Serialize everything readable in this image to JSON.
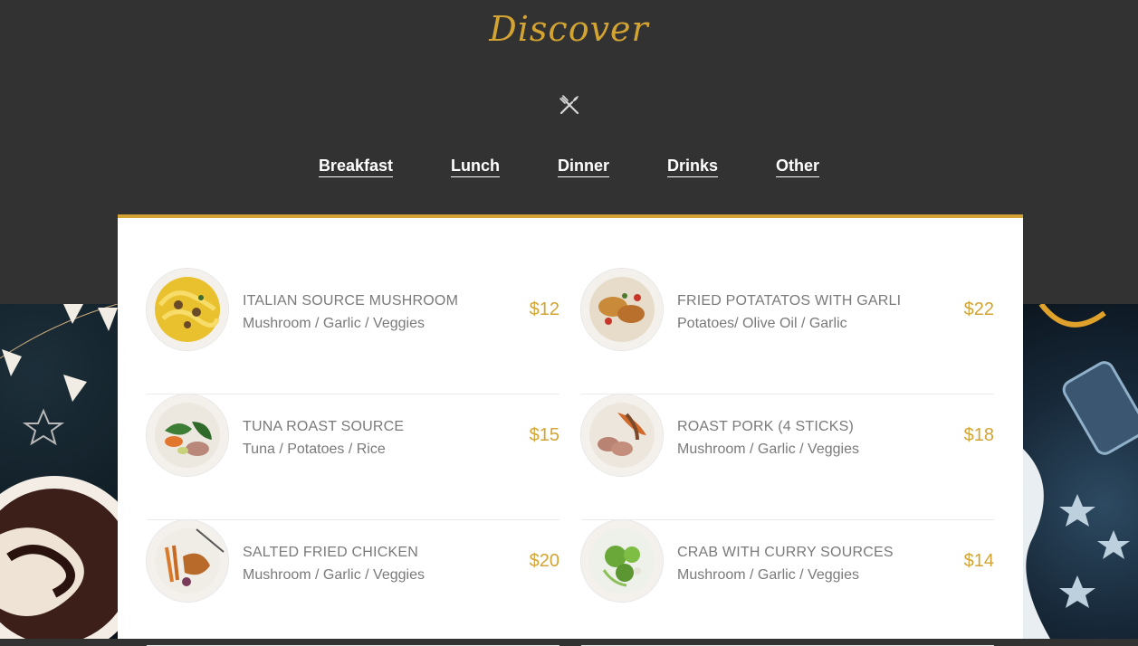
{
  "header": {
    "title": "Discover",
    "icon": "utensils-icon"
  },
  "tabs": [
    {
      "label": "Breakfast"
    },
    {
      "label": "Lunch"
    },
    {
      "label": "Dinner"
    },
    {
      "label": "Drinks"
    },
    {
      "label": "Other"
    }
  ],
  "colors": {
    "accent": "#d4a432",
    "background": "#323232",
    "text": "#7a7a7a"
  },
  "menu": {
    "items": [
      {
        "name": "ITALIAN SOURCE MUSHROOM",
        "desc": "Mushroom / Garlic / Veggies",
        "price": "$12"
      },
      {
        "name": "FRIED POTATATOS WITH GARLI",
        "desc": "Potatoes/ Olive Oil / Garlic",
        "price": "$22"
      },
      {
        "name": "TUNA ROAST SOURCE",
        "desc": "Tuna / Potatoes / Rice",
        "price": "$15"
      },
      {
        "name": "ROAST PORK (4 STICKS)",
        "desc": "Mushroom / Garlic / Veggies",
        "price": "$18"
      },
      {
        "name": "SALTED FRIED CHICKEN",
        "desc": "Mushroom / Garlic / Veggies",
        "price": "$20"
      },
      {
        "name": "CRAB WITH CURRY SOURCES",
        "desc": "Mushroom / Garlic / Veggies",
        "price": "$14"
      }
    ]
  }
}
